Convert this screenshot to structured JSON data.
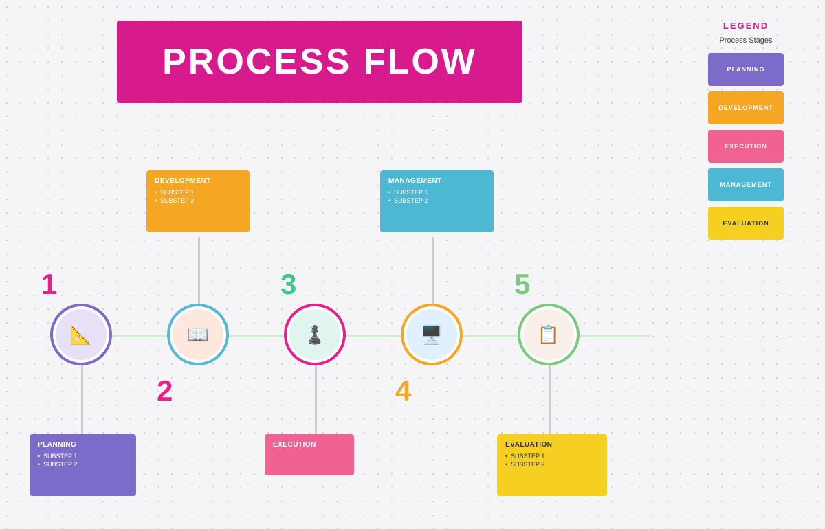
{
  "title": "PROCESS FLOW",
  "legend": {
    "title": "LEGEND",
    "subtitle": "Process Stages",
    "items": [
      {
        "label": "PLANNING",
        "color": "#7c6bc9"
      },
      {
        "label": "DEVELOPMENT",
        "color": "#f5a623"
      },
      {
        "label": "EXECUTION",
        "color": "#f06292"
      },
      {
        "label": "MANAGEMENT",
        "color": "#4db8d4"
      },
      {
        "label": "EVALUATION",
        "color": "#f5d020"
      }
    ]
  },
  "stages": [
    {
      "number": "1",
      "position": "bottom",
      "card_title": "PLANNING",
      "substeps": [
        "SUBSTEP 1",
        "SUBSTEP 2"
      ],
      "color": "#7c6bc9",
      "number_color": "#e91e8c",
      "icon": "📐"
    },
    {
      "number": "2",
      "position": "top",
      "card_title": "DEVELOPMENT",
      "substeps": [
        "SUBSTEP 1",
        "SUBSTEP 2"
      ],
      "color": "#f5a623",
      "number_color": "#e91e8c",
      "icon": "📖"
    },
    {
      "number": "3",
      "position": "bottom",
      "card_title": "EXECUTION",
      "substeps": [],
      "color": "#f06292",
      "number_color": "#3fc88e",
      "icon": "♟️"
    },
    {
      "number": "4",
      "position": "top",
      "card_title": "MANAGEMENT",
      "substeps": [
        "SUBSTEP 1",
        "SUBSTEP 2"
      ],
      "color": "#4db8d4",
      "number_color": "#f5a623",
      "icon": "🖥️"
    },
    {
      "number": "5",
      "position": "bottom",
      "card_title": "EVALUATION",
      "substeps": [
        "SUBSTEP 1",
        "SUBSTEP 2"
      ],
      "color": "#f5d020",
      "number_color": "#7bc97c",
      "icon": "📋"
    }
  ]
}
